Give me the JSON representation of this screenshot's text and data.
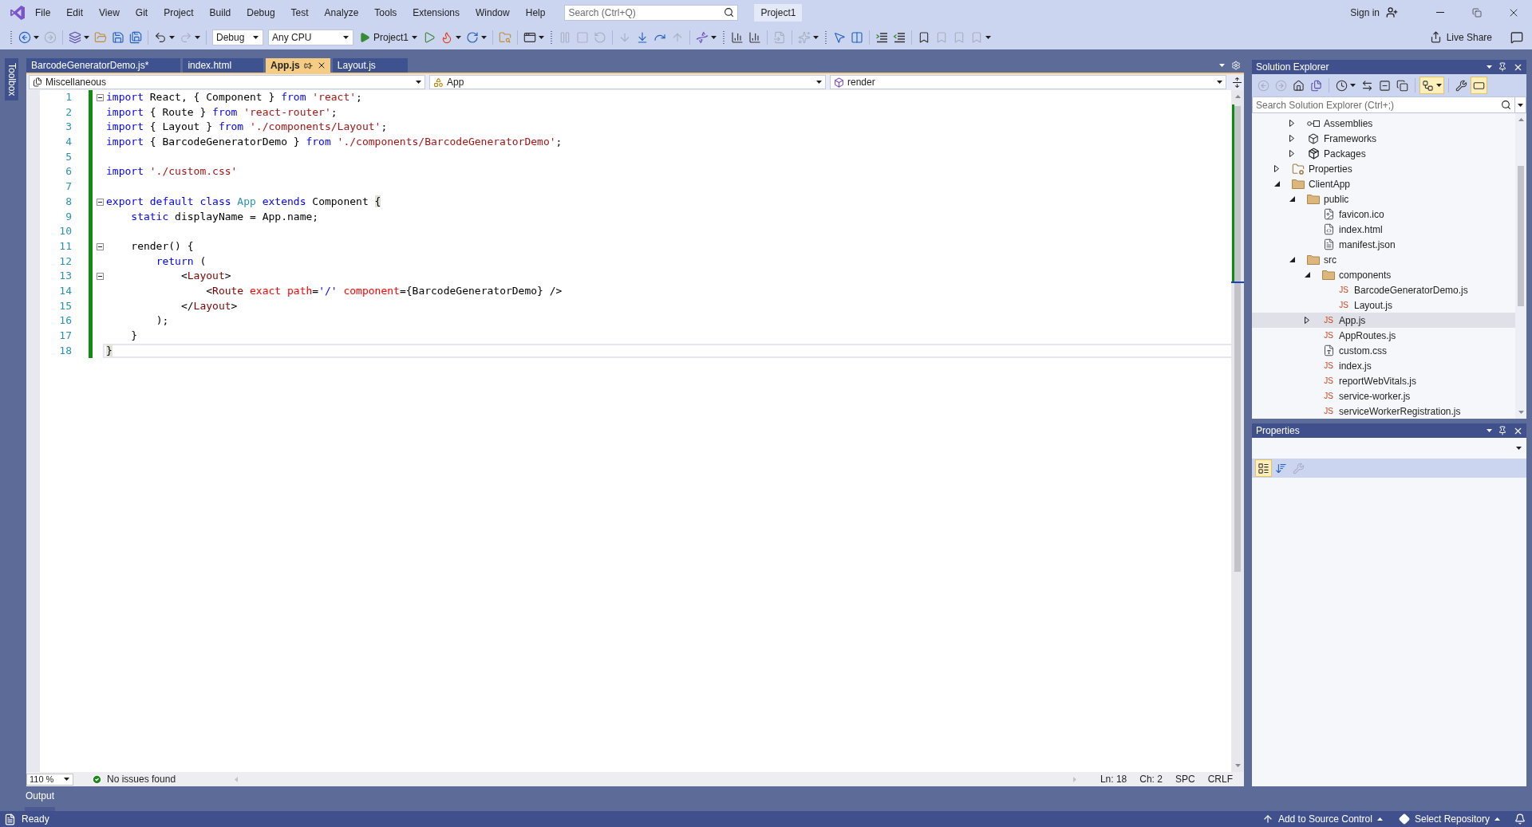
{
  "menu_bar": {
    "menus": [
      "File",
      "Edit",
      "View",
      "Git",
      "Project",
      "Build",
      "Debug",
      "Test",
      "Analyze",
      "Tools",
      "Extensions",
      "Window",
      "Help"
    ],
    "search": {
      "placeholder": "Search (Ctrl+Q)"
    },
    "solution_name": "Project1",
    "sign_in": "Sign in"
  },
  "toolbar": {
    "items": [
      {
        "kind": "grip"
      },
      {
        "kind": "button",
        "disabled": false,
        "menu": true
      },
      {
        "kind": "button",
        "disabled": true,
        "menu": false
      },
      {
        "kind": "separator"
      },
      {
        "kind": "button",
        "disabled": false,
        "menu": true
      },
      {
        "kind": "button",
        "disabled": false,
        "menu": false
      },
      {
        "kind": "button",
        "disabled": false,
        "menu": false
      },
      {
        "kind": "button",
        "disabled": false,
        "menu": false
      },
      {
        "kind": "separator"
      },
      {
        "kind": "button",
        "disabled": false,
        "menu": true
      },
      {
        "kind": "button",
        "disabled": true,
        "menu": true
      },
      {
        "kind": "separator"
      },
      {
        "kind": "select",
        "value": "Debug"
      },
      {
        "kind": "select",
        "value": "Any CPU"
      },
      {
        "kind": "run",
        "label": "Project1"
      },
      {
        "kind": "button",
        "disabled": false,
        "menu": false
      },
      {
        "kind": "button",
        "disabled": false,
        "menu": true
      },
      {
        "kind": "button",
        "disabled": false,
        "menu": true
      },
      {
        "kind": "separator"
      },
      {
        "kind": "button",
        "disabled": false,
        "menu": false
      },
      {
        "kind": "separator"
      },
      {
        "kind": "button",
        "disabled": false,
        "menu": true
      },
      {
        "kind": "grip"
      },
      {
        "kind": "button",
        "disabled": true,
        "menu": false
      },
      {
        "kind": "button",
        "disabled": true,
        "menu": false
      },
      {
        "kind": "button",
        "disabled": true,
        "menu": false
      },
      {
        "kind": "separator"
      },
      {
        "kind": "button",
        "disabled": true,
        "menu": false
      },
      {
        "kind": "button",
        "disabled": false,
        "menu": false
      },
      {
        "kind": "button",
        "disabled": false,
        "menu": false
      },
      {
        "kind": "button",
        "disabled": true,
        "menu": false
      },
      {
        "kind": "separator"
      },
      {
        "kind": "button",
        "disabled": false,
        "menu": true
      },
      {
        "kind": "grip"
      },
      {
        "kind": "button",
        "disabled": false,
        "menu": false
      },
      {
        "kind": "button",
        "disabled": false,
        "menu": false
      },
      {
        "kind": "separator"
      },
      {
        "kind": "button",
        "disabled": true,
        "menu": false
      },
      {
        "kind": "separator"
      },
      {
        "kind": "button",
        "disabled": true,
        "menu": true
      },
      {
        "kind": "grip"
      },
      {
        "kind": "button",
        "disabled": false,
        "menu": false
      },
      {
        "kind": "button",
        "disabled": false,
        "menu": false
      },
      {
        "kind": "separator"
      },
      {
        "kind": "button",
        "disabled": false,
        "menu": false
      },
      {
        "kind": "button",
        "disabled": false,
        "menu": false
      },
      {
        "kind": "separator"
      },
      {
        "kind": "button",
        "disabled": false,
        "menu": false
      },
      {
        "kind": "button",
        "disabled": true,
        "menu": false
      },
      {
        "kind": "button",
        "disabled": true,
        "menu": false
      },
      {
        "kind": "button",
        "disabled": true,
        "menu": true
      }
    ],
    "live_share": "Live Share"
  },
  "toolbox": {
    "label": "Toolbox"
  },
  "document_tabs": [
    {
      "label": "BarcodeGeneratorDemo.js*",
      "selected": false
    },
    {
      "label": "index.html",
      "selected": false
    },
    {
      "label": "App.js",
      "selected": true
    },
    {
      "label": "Layout.js",
      "selected": false
    }
  ],
  "navigation_bar": {
    "project": "Miscellaneous",
    "type": "App",
    "member": "render"
  },
  "editor": {
    "lines": [
      {
        "number": "1",
        "changed": true,
        "current": false,
        "outline": {
          "expanded": true
        },
        "tokens": [
          {
            "kind": "keyword",
            "text": "import"
          },
          {
            "kind": "plain",
            "text": " React, { Component } "
          },
          {
            "kind": "keyword",
            "text": "from"
          },
          {
            "kind": "string",
            "text": " 'react'"
          },
          {
            "kind": "plain",
            "text": ";"
          }
        ]
      },
      {
        "number": "2",
        "changed": true,
        "current": false,
        "tokens": [
          {
            "kind": "keyword",
            "text": "import"
          },
          {
            "kind": "plain",
            "text": " { Route } "
          },
          {
            "kind": "keyword",
            "text": "from"
          },
          {
            "kind": "string",
            "text": " 'react-router'"
          },
          {
            "kind": "plain",
            "text": ";"
          }
        ]
      },
      {
        "number": "3",
        "changed": true,
        "current": false,
        "tokens": [
          {
            "kind": "keyword",
            "text": "import"
          },
          {
            "kind": "plain",
            "text": " { Layout } "
          },
          {
            "kind": "keyword",
            "text": "from"
          },
          {
            "kind": "string",
            "text": " './components/Layout'"
          },
          {
            "kind": "plain",
            "text": ";"
          }
        ]
      },
      {
        "number": "4",
        "changed": true,
        "current": false,
        "tokens": [
          {
            "kind": "keyword",
            "text": "import"
          },
          {
            "kind": "plain",
            "text": " { BarcodeGeneratorDemo } "
          },
          {
            "kind": "keyword",
            "text": "from"
          },
          {
            "kind": "string",
            "text": " './components/BarcodeGeneratorDemo'"
          },
          {
            "kind": "plain",
            "text": ";"
          }
        ]
      },
      {
        "number": "5",
        "changed": true,
        "current": false
      },
      {
        "number": "6",
        "changed": true,
        "current": false,
        "tokens": [
          {
            "kind": "keyword",
            "text": "import"
          },
          {
            "kind": "string",
            "text": " './custom.css'"
          }
        ]
      },
      {
        "number": "7",
        "changed": true,
        "current": false
      },
      {
        "number": "8",
        "changed": true,
        "current": false,
        "outline": {
          "expanded": true
        },
        "tokens": [
          {
            "kind": "keyword",
            "text": "export default class"
          },
          {
            "kind": "class",
            "text": " App"
          },
          {
            "kind": "keyword",
            "text": " extends"
          },
          {
            "kind": "plain",
            "text": " Component "
          },
          {
            "kind": "brace",
            "text": "{"
          }
        ]
      },
      {
        "number": "9",
        "changed": true,
        "current": false,
        "tokens": [
          {
            "kind": "keyword",
            "text": "    static"
          },
          {
            "kind": "plain",
            "text": " displayName = App.name;"
          }
        ]
      },
      {
        "number": "10",
        "changed": true,
        "current": false
      },
      {
        "number": "11",
        "changed": true,
        "current": false,
        "outline": {
          "expanded": true
        },
        "tokens": [
          {
            "kind": "plain",
            "text": "    render() {"
          }
        ]
      },
      {
        "number": "12",
        "changed": true,
        "current": false,
        "tokens": [
          {
            "kind": "keyword",
            "text": "        return"
          },
          {
            "kind": "plain",
            "text": " ("
          }
        ]
      },
      {
        "number": "13",
        "changed": true,
        "current": false,
        "outline": {
          "expanded": true
        },
        "tokens": [
          {
            "kind": "plain",
            "text": "            <"
          },
          {
            "kind": "tag",
            "text": "Layout"
          },
          {
            "kind": "plain",
            "text": ">"
          }
        ]
      },
      {
        "number": "14",
        "changed": true,
        "current": false,
        "tokens": [
          {
            "kind": "plain",
            "text": "                <"
          },
          {
            "kind": "tag",
            "text": "Route"
          },
          {
            "kind": "attribute",
            "text": " exact"
          },
          {
            "kind": "attribute",
            "text": " path"
          },
          {
            "kind": "plain",
            "text": "="
          },
          {
            "kind": "value",
            "text": "'/'"
          },
          {
            "kind": "attribute",
            "text": " component"
          },
          {
            "kind": "plain",
            "text": "={BarcodeGeneratorDemo} />"
          }
        ]
      },
      {
        "number": "15",
        "changed": true,
        "current": false,
        "tokens": [
          {
            "kind": "plain",
            "text": "            </"
          },
          {
            "kind": "tag",
            "text": "Layout"
          },
          {
            "kind": "plain",
            "text": ">"
          }
        ]
      },
      {
        "number": "16",
        "changed": true,
        "current": false,
        "tokens": [
          {
            "kind": "plain",
            "text": "        );"
          }
        ]
      },
      {
        "number": "17",
        "changed": true,
        "current": false,
        "tokens": [
          {
            "kind": "plain",
            "text": "    }"
          }
        ]
      },
      {
        "number": "18",
        "changed": true,
        "current": true,
        "tokens": [
          {
            "kind": "brace",
            "text": "}"
          }
        ]
      }
    ],
    "zoom": "110 %",
    "issues": "No issues found",
    "position": {
      "line": "Ln: 18",
      "column": "Ch: 2"
    },
    "whitespace": "SPC",
    "line_ending": "CRLF"
  },
  "solution_explorer": {
    "title": "Solution Explorer",
    "toolbar": [
      {
        "kind": "button",
        "disabled": true,
        "on": false,
        "menu": false
      },
      {
        "kind": "button",
        "disabled": true,
        "on": false,
        "menu": false
      },
      {
        "kind": "button",
        "disabled": false,
        "on": false,
        "menu": false
      },
      {
        "kind": "button",
        "disabled": false,
        "on": false,
        "menu": false
      },
      {
        "kind": "separator"
      },
      {
        "kind": "button",
        "disabled": false,
        "on": false,
        "menu": true
      },
      {
        "kind": "button",
        "disabled": false,
        "on": false,
        "menu": false
      },
      {
        "kind": "button",
        "disabled": false,
        "on": false,
        "menu": false
      },
      {
        "kind": "button",
        "disabled": false,
        "on": false,
        "menu": false
      },
      {
        "kind": "separator"
      },
      {
        "kind": "button",
        "disabled": false,
        "on": true,
        "menu": true
      },
      {
        "kind": "separator"
      },
      {
        "kind": "button",
        "disabled": false,
        "on": false,
        "menu": false
      },
      {
        "kind": "button",
        "disabled": false,
        "on": true,
        "menu": false
      }
    ],
    "search": {
      "placeholder": "Search Solution Explorer (Ctrl+;)"
    },
    "tree": [
      {
        "children": [
          {
            "label": "Assemblies",
            "kind": "assemblies",
            "expanded": false,
            "selected": false
          },
          {
            "label": "Frameworks",
            "kind": "frameworks",
            "expanded": false,
            "selected": false
          },
          {
            "label": "Packages",
            "kind": "packages",
            "expanded": false,
            "selected": false
          }
        ]
      },
      {
        "label": "Properties",
        "kind": "properties",
        "expanded": false,
        "selected": false
      },
      {
        "label": "ClientApp",
        "kind": "folder",
        "expanded": true,
        "selected": false,
        "children": [
          {
            "label": "public",
            "kind": "folder",
            "expanded": true,
            "selected": false,
            "children": [
              {
                "label": "favicon.ico",
                "kind": "image",
                "selected": false
              },
              {
                "label": "index.html",
                "kind": "html",
                "selected": false
              },
              {
                "label": "manifest.json",
                "kind": "json",
                "selected": false
              }
            ]
          },
          {
            "label": "src",
            "kind": "folder",
            "expanded": true,
            "selected": false,
            "children": [
              {
                "label": "components",
                "kind": "folder",
                "expanded": true,
                "selected": false,
                "children": [
                  {
                    "label": "BarcodeGeneratorDemo.js",
                    "kind": "js",
                    "icon_text": "JS",
                    "selected": false
                  },
                  {
                    "label": "Layout.js",
                    "kind": "js",
                    "icon_text": "JS",
                    "selected": false
                  }
                ]
              },
              {
                "label": "App.js",
                "kind": "js",
                "icon_text": "JS",
                "expanded": false,
                "selected": true
              },
              {
                "label": "AppRoutes.js",
                "kind": "js",
                "icon_text": "JS",
                "selected": false
              },
              {
                "label": "custom.css",
                "kind": "css",
                "selected": false
              },
              {
                "label": "index.js",
                "kind": "js",
                "icon_text": "JS",
                "selected": false
              },
              {
                "label": "reportWebVitals.js",
                "kind": "js",
                "icon_text": "JS",
                "selected": false
              },
              {
                "label": "service-worker.js",
                "kind": "js",
                "icon_text": "JS",
                "selected": false
              },
              {
                "label": "serviceWorkerRegistration.js",
                "kind": "js",
                "icon_text": "JS",
                "selected": false
              }
            ]
          }
        ]
      }
    ]
  },
  "properties": {
    "title": "Properties",
    "toolbar": [
      {
        "on": true,
        "disabled": false
      },
      {
        "on": false,
        "disabled": false
      },
      {
        "on": false,
        "disabled": true
      }
    ]
  },
  "output_tab": {
    "label": "Output"
  },
  "status_bar": {
    "message": "Ready",
    "source_control": "Add to Source Control",
    "repository": "Select Repository"
  }
}
